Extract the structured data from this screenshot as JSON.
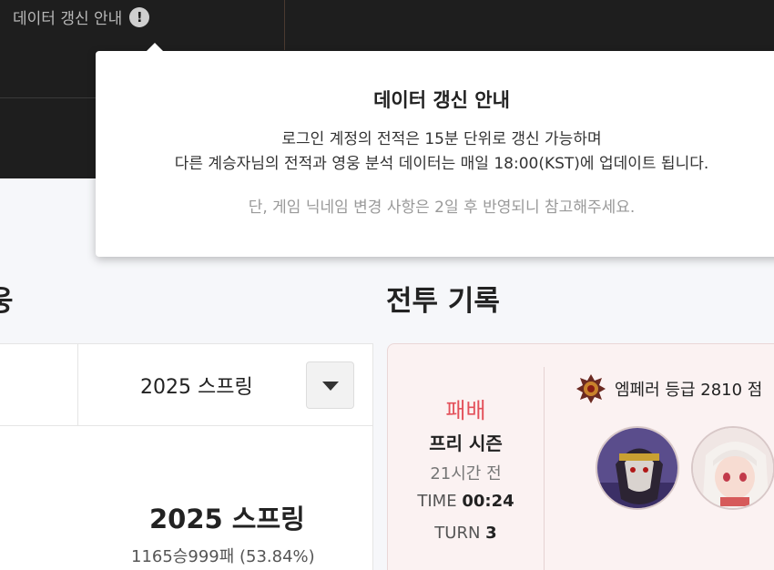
{
  "header": {
    "notice_link": "데이터 갱신 안내",
    "notice_icon": "exclamation-icon"
  },
  "popover": {
    "title": "데이터 갱신 안내",
    "line1": "로그인 계정의 전적은 15분 단위로 갱신 가능하며",
    "line2": "다른 계승자님의 전적과 영웅 분석 데이터는 매일 18:00(KST)에 업데이트 됩니다.",
    "note": "단, 게임 닉네임 변경 사항은 2일 후 반영되니 참고해주세요."
  },
  "hero_section": {
    "heading": "웅",
    "season_select": {
      "selected": "2025 스프링",
      "icon": "chevron-down-icon"
    },
    "season_title": "2025 스프링",
    "record": "1165승999패 (53.84%)"
  },
  "battle_section": {
    "heading": "전투 기록",
    "match": {
      "result": "패배",
      "result_color": "#e3505a",
      "mode": "프리 시즌",
      "ago": "21시간 전",
      "time_label": "TIME",
      "time_value": "00:24",
      "turn_label": "TURN",
      "turn_value": "3",
      "rank_icon": "emperor-emblem-icon",
      "rank_text": "엠페러 등급 2810 점"
    }
  },
  "colors": {
    "topbar_bg": "#1e1e1e",
    "loss_red": "#e3505a",
    "match_card_bg": "#fbf2f2"
  }
}
